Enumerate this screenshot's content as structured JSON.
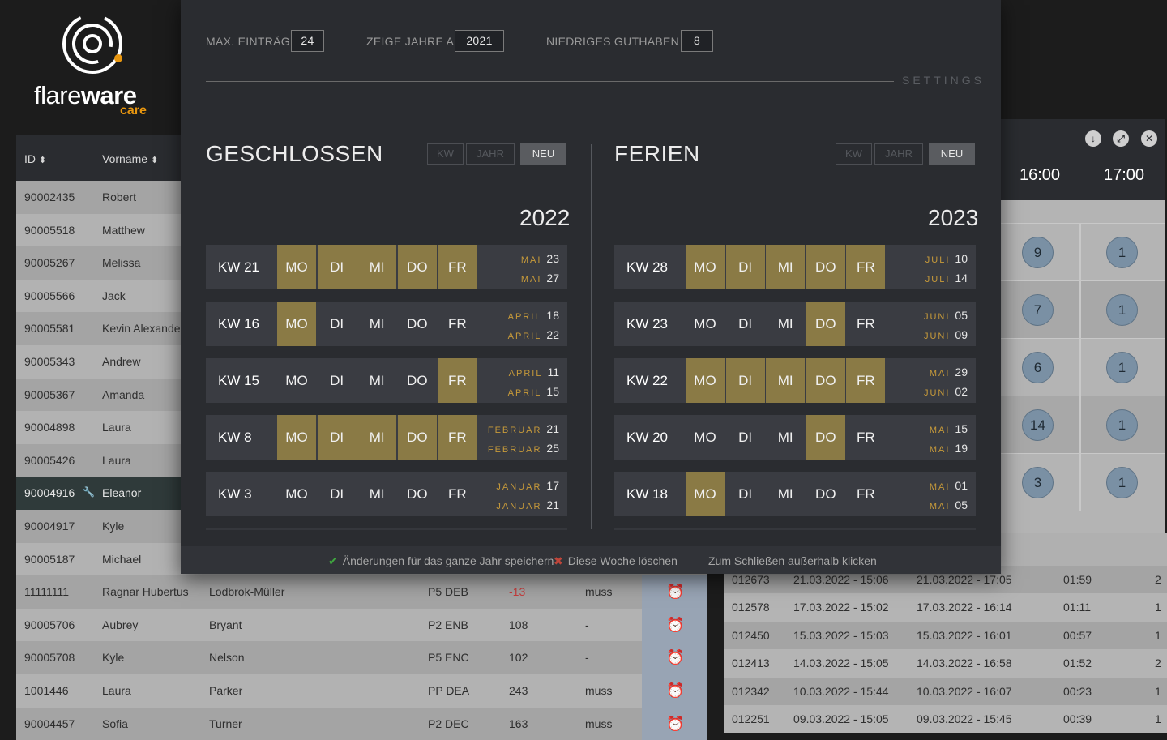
{
  "brand": {
    "name_light": "flare",
    "name_bold": "ware",
    "sub": "care"
  },
  "table": {
    "headers": {
      "id": "ID",
      "vorname": "Vorname"
    },
    "rows": [
      {
        "id": "90002435",
        "vorname": "Robert"
      },
      {
        "id": "90005518",
        "vorname": "Matthew"
      },
      {
        "id": "90005267",
        "vorname": "Melissa"
      },
      {
        "id": "90005566",
        "vorname": "Jack"
      },
      {
        "id": "90005581",
        "vorname": "Kevin Alexander"
      },
      {
        "id": "90005343",
        "vorname": "Andrew"
      },
      {
        "id": "90005367",
        "vorname": "Amanda"
      },
      {
        "id": "90004898",
        "vorname": "Laura"
      },
      {
        "id": "90005426",
        "vorname": "Laura"
      },
      {
        "id": "90004916",
        "vorname": "Eleanor",
        "selected": true
      },
      {
        "id": "90004917",
        "vorname": "Kyle"
      },
      {
        "id": "90005187",
        "vorname": "Michael"
      },
      {
        "id": "11111111",
        "vorname": "Ragnar Hubertus",
        "nachname": "Lodbrok-Müller",
        "gruppe": "P5 DEB",
        "guthaben": "-13",
        "status": "muss",
        "negative": true
      },
      {
        "id": "90005706",
        "vorname": "Aubrey",
        "nachname": "Bryant",
        "gruppe": "P2 ENB",
        "guthaben": "108",
        "status": "-"
      },
      {
        "id": "90005708",
        "vorname": "Kyle",
        "nachname": "Nelson",
        "gruppe": "P5 ENC",
        "guthaben": "102",
        "status": "-"
      },
      {
        "id": "1001446",
        "vorname": "Laura",
        "nachname": "Parker",
        "gruppe": "PP DEA",
        "guthaben": "243",
        "status": "muss"
      },
      {
        "id": "90004457",
        "vorname": "Sofia",
        "nachname": "Turner",
        "gruppe": "P2 DEC",
        "guthaben": "163",
        "status": "muss"
      }
    ]
  },
  "right_panel": {
    "times": [
      "16:00",
      "17:00"
    ],
    "icons": [
      "download-icon",
      "expand-icon",
      "close-icon"
    ],
    "rows": [
      {
        "a": "9",
        "b": "1"
      },
      {
        "a": "7",
        "b": "1"
      },
      {
        "a": "6",
        "b": "1"
      },
      {
        "a": "14",
        "b": "1"
      },
      {
        "a": "3",
        "b": "1"
      }
    ]
  },
  "log_table": {
    "rows": [
      {
        "id": "012673",
        "start": "21.03.2022 - 15:06",
        "end": "21.03.2022 - 17:05",
        "dur": "01:59",
        "n": "2"
      },
      {
        "id": "012578",
        "start": "17.03.2022 - 15:02",
        "end": "17.03.2022 - 16:14",
        "dur": "01:11",
        "n": "1"
      },
      {
        "id": "012450",
        "start": "15.03.2022 - 15:03",
        "end": "15.03.2022 - 16:01",
        "dur": "00:57",
        "n": "1"
      },
      {
        "id": "012413",
        "start": "14.03.2022 - 15:05",
        "end": "14.03.2022 - 16:58",
        "dur": "01:52",
        "n": "2"
      },
      {
        "id": "012342",
        "start": "10.03.2022 - 15:44",
        "end": "10.03.2022 - 16:07",
        "dur": "00:23",
        "n": "1"
      },
      {
        "id": "012251",
        "start": "09.03.2022 - 15:05",
        "end": "09.03.2022 - 15:45",
        "dur": "00:39",
        "n": "1"
      }
    ]
  },
  "modal": {
    "settings": {
      "max_label": "MAX. EINTRÄGE",
      "max_value": "24",
      "year_label": "ZEIGE JAHRE AB",
      "year_value": "2021",
      "low_label": "NIEDRIGES GUTHABEN AB",
      "low_value": "8",
      "title": "SETTINGS"
    },
    "sections": [
      {
        "title": "GESCHLOSSEN",
        "buttons": [
          "KW",
          "JAHR",
          "NEU"
        ],
        "year": "2022",
        "weeks": [
          {
            "kw": "KW 21",
            "days": [
              true,
              true,
              true,
              true,
              true
            ],
            "from_month": "MAI",
            "from_day": "23",
            "to_month": "MAI",
            "to_day": "27"
          },
          {
            "kw": "KW 16",
            "days": [
              true,
              false,
              false,
              false,
              false
            ],
            "from_month": "APRIL",
            "from_day": "18",
            "to_month": "APRIL",
            "to_day": "22"
          },
          {
            "kw": "KW 15",
            "days": [
              false,
              false,
              false,
              false,
              true
            ],
            "from_month": "APRIL",
            "from_day": "11",
            "to_month": "APRIL",
            "to_day": "15"
          },
          {
            "kw": "KW 8",
            "days": [
              true,
              true,
              true,
              true,
              true
            ],
            "from_month": "FEBRUAR",
            "from_day": "21",
            "to_month": "FEBRUAR",
            "to_day": "25"
          },
          {
            "kw": "KW 3",
            "days": [
              false,
              false,
              false,
              false,
              false
            ],
            "from_month": "JANUAR",
            "from_day": "17",
            "to_month": "JANUAR",
            "to_day": "21"
          }
        ]
      },
      {
        "title": "FERIEN",
        "buttons": [
          "KW",
          "JAHR",
          "NEU"
        ],
        "year": "2023",
        "weeks": [
          {
            "kw": "KW 28",
            "days": [
              true,
              true,
              true,
              true,
              true
            ],
            "from_month": "JULI",
            "from_day": "10",
            "to_month": "JULI",
            "to_day": "14"
          },
          {
            "kw": "KW 23",
            "days": [
              false,
              false,
              false,
              true,
              false
            ],
            "from_month": "JUNI",
            "from_day": "05",
            "to_month": "JUNI",
            "to_day": "09"
          },
          {
            "kw": "KW 22",
            "days": [
              true,
              true,
              true,
              true,
              true
            ],
            "from_month": "MAI",
            "from_day": "29",
            "to_month": "JUNI",
            "to_day": "02"
          },
          {
            "kw": "KW 20",
            "days": [
              false,
              false,
              false,
              true,
              false
            ],
            "from_month": "MAI",
            "from_day": "15",
            "to_month": "MAI",
            "to_day": "19"
          },
          {
            "kw": "KW 18",
            "days": [
              true,
              false,
              false,
              false,
              false
            ],
            "from_month": "MAI",
            "from_day": "01",
            "to_month": "MAI",
            "to_day": "05"
          }
        ]
      }
    ],
    "day_labels": [
      "MO",
      "DI",
      "MI",
      "DO",
      "FR"
    ],
    "footer": {
      "save": "Änderungen für das ganze Jahr speichern",
      "delete": "Diese Woche löschen",
      "close_hint": "Zum Schließen außerhalb klicken"
    },
    "colors": {
      "accent": "#8a7a45",
      "month": "#c79a3a",
      "ok": "#3fa63f",
      "danger": "#c0453a"
    }
  }
}
